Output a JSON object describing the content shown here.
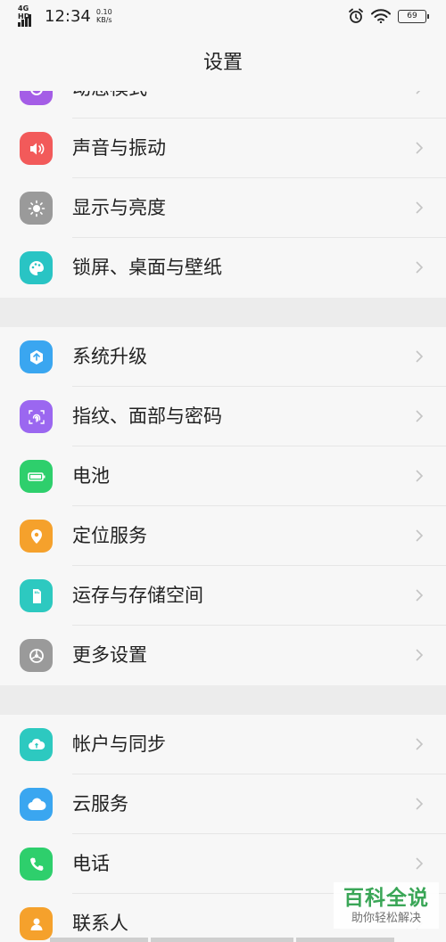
{
  "status_bar": {
    "network": "4G HD",
    "time": "12:34",
    "speed_value": "0.10",
    "speed_unit": "KB/s",
    "battery": "69"
  },
  "title": "设置",
  "groups": [
    [
      {
        "label": "动态模式",
        "icon": "motion-icon",
        "color": "#a45de6"
      },
      {
        "label": "声音与振动",
        "icon": "speaker-icon",
        "color": "#f25a5a"
      },
      {
        "label": "显示与亮度",
        "icon": "sun-icon",
        "color": "#9a9a9a"
      },
      {
        "label": "锁屏、桌面与壁纸",
        "icon": "palette-icon",
        "color": "#29c4c4"
      }
    ],
    [
      {
        "label": "系统升级",
        "icon": "system-update-icon",
        "color": "#3aa6f0"
      },
      {
        "label": "指纹、面部与密码",
        "icon": "fingerprint-icon",
        "color": "#9b67f0"
      },
      {
        "label": "电池",
        "icon": "battery-icon",
        "color": "#2ecf6c"
      },
      {
        "label": "定位服务",
        "icon": "location-icon",
        "color": "#f5a12c"
      },
      {
        "label": "运存与存储空间",
        "icon": "storage-icon",
        "color": "#2dc9c0"
      },
      {
        "label": "更多设置",
        "icon": "more-settings-gear-icon",
        "color": "#9a9a9a"
      }
    ],
    [
      {
        "label": "帐户与同步",
        "icon": "account-sync-icon",
        "color": "#2dc9c0"
      },
      {
        "label": "云服务",
        "icon": "cloud-icon",
        "color": "#3aa6f0"
      },
      {
        "label": "电话",
        "icon": "phone-icon",
        "color": "#2ecf6c"
      },
      {
        "label": "联系人",
        "icon": "contacts-icon",
        "color": "#f5a12c"
      }
    ]
  ],
  "watermark": {
    "title": "百科全说",
    "subtitle": "助你轻松解决"
  }
}
